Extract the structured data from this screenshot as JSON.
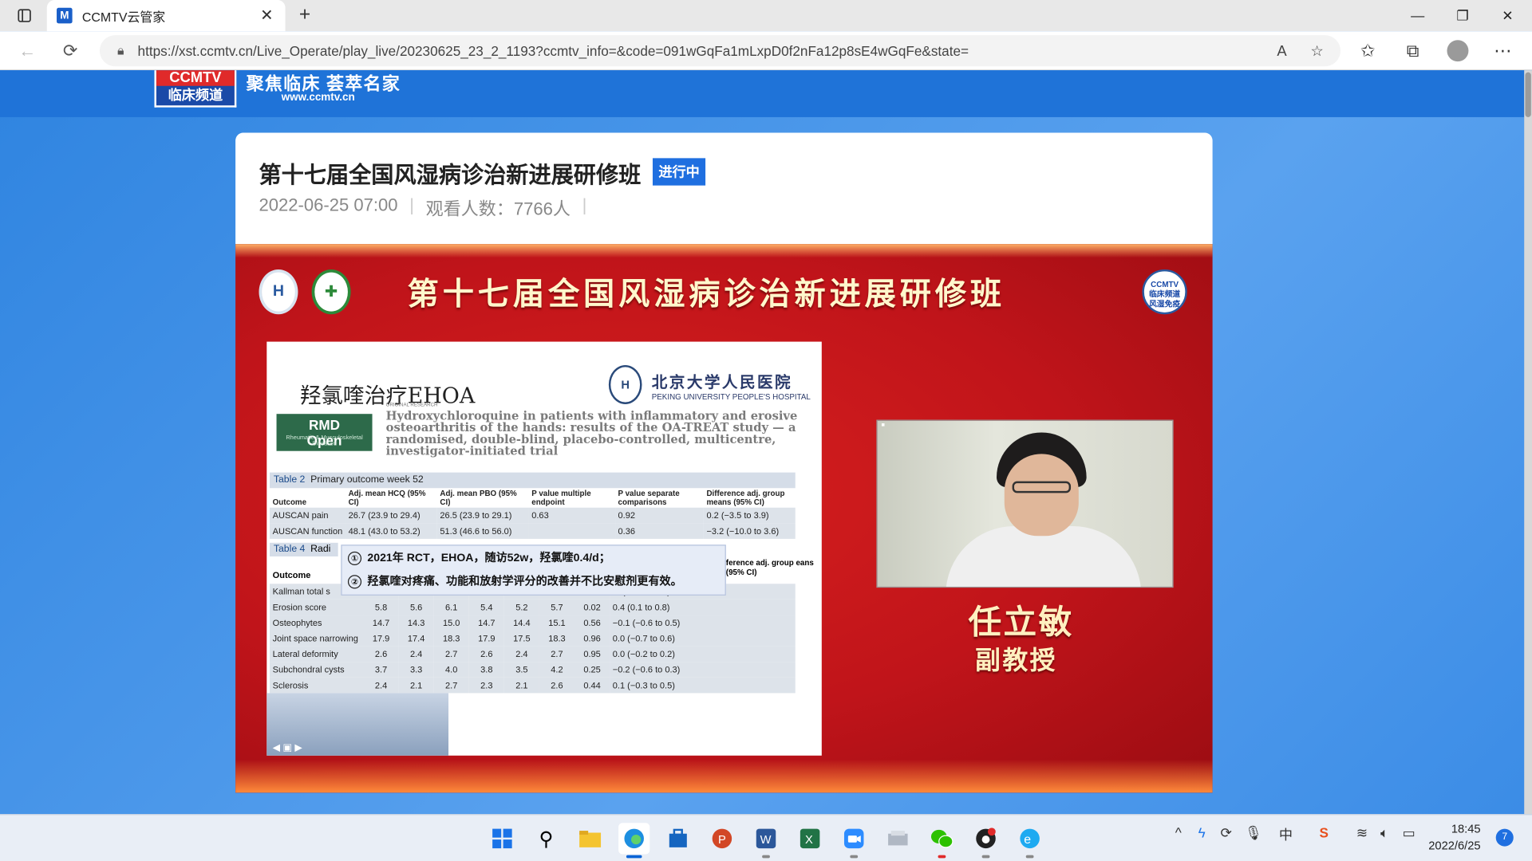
{
  "browser": {
    "tab_title": "CCMTV云管家",
    "tab_favicon": "M",
    "url": "https://xst.ccmtv.cn/Live_Operate/play_live/20230625_23_2_1193?ccmtv_info=&code=091wGqFa1mLxpD0f2nFa12p8sE4wGqFe&state="
  },
  "site": {
    "logo_top": "CCMTV",
    "logo_bottom": "临床频道",
    "slogan": "聚焦临床 荟萃名家",
    "site_url": "www.ccmtv.cn"
  },
  "live": {
    "title": "第十七届全国风湿病诊治新进展研修班",
    "status_badge": "进行中",
    "datetime": "2022-06-25 07:00",
    "viewers": "观看人数：7766人"
  },
  "video": {
    "banner_title": "第十七届全国风湿病诊治新进展研修班",
    "ccmtv_badge_top": "CCMTV",
    "ccmtv_badge_mid": "临床频道",
    "ccmtv_badge_bottom": "风湿免疫",
    "speaker_name": "任立敏",
    "speaker_title": "副教授"
  },
  "slide": {
    "title": "羟氯喹治疗EHOA",
    "hospital_cn": "北京大学人民医院",
    "hospital_en": "PEKING UNIVERSITY PEOPLE'S HOSPITAL",
    "journal_line1": "RMD",
    "journal_line2": "Open",
    "journal_sub": "Rheumatic & Musculoskeletal Diseases",
    "paper_kind": "ORIGINAL RESEARCH",
    "paper_title": "Hydroxychloroquine in patients with inflammatory and erosive osteoarthritis of the hands: results of the OA-TREAT study — a randomised, double-blind, placebo-controlled, multicentre, investigator-initiated trial",
    "table2_caption_label": "Table 2",
    "table2_caption": "Primary outcome week 52",
    "table2_headers": [
      "Outcome",
      "Adj. mean HCQ (95% CI)",
      "Adj. mean PBO (95% CI)",
      "P value multiple endpoint",
      "P value separate comparisons",
      "Difference adj. group means (95% CI)"
    ],
    "table2_rows": [
      [
        "AUSCAN pain",
        "26.7 (23.9 to 29.4)",
        "26.5 (23.9 to 29.1)",
        "0.63",
        "0.92",
        "0.2 (−3.5 to 3.9)"
      ],
      [
        "AUSCAN function",
        "48.1 (43.0 to 53.2)",
        "51.3 (46.6 to 56.0)",
        "",
        "0.36",
        "−3.2 (−10.0 to 3.6)"
      ]
    ],
    "table4_caption_label": "Table 4",
    "table4_caption": "Radi",
    "table4_header_outcome": "Outcome",
    "table4_header_diff": "ference adj. group eans (95% CI)",
    "table4_rows": [
      [
        "Kallman total s",
        "",
        "",
        "",
        "",
        "",
        "",
        "",
        ".3 (−1.2 to 1.9)"
      ],
      [
        "Erosion score",
        "5.8",
        "5.6",
        "6.1",
        "5.4",
        "5.2",
        "5.7",
        "0.02",
        "0.4 (0.1 to 0.8)"
      ],
      [
        "Osteophytes",
        "14.7",
        "14.3",
        "15.0",
        "14.7",
        "14.4",
        "15.1",
        "0.56",
        "−0.1 (−0.6 to 0.5)"
      ],
      [
        "Joint space narrowing",
        "17.9",
        "17.4",
        "18.3",
        "17.9",
        "17.5",
        "18.3",
        "0.96",
        "0.0 (−0.7 to 0.6)"
      ],
      [
        "Lateral deformity",
        "2.6",
        "2.4",
        "2.7",
        "2.6",
        "2.4",
        "2.7",
        "0.95",
        "0.0 (−0.2 to 0.2)"
      ],
      [
        "Subchondral cysts",
        "3.7",
        "3.3",
        "4.0",
        "3.8",
        "3.5",
        "4.2",
        "0.25",
        "−0.2 (−0.6 to 0.3)"
      ],
      [
        "Sclerosis",
        "2.4",
        "2.1",
        "2.7",
        "2.3",
        "2.1",
        "2.6",
        "0.44",
        "0.1 (−0.3 to 0.5)"
      ]
    ],
    "callout_1_num": "①",
    "callout_1": "2021年 RCT，EHOA，随访52w，羟氯喹0.4/d；",
    "callout_2_num": "②",
    "callout_2": "羟氯喹对疼痛、功能和放射学评分的改善并不比安慰剂更有效。"
  },
  "taskbar": {
    "time": "18:45",
    "date": "2022/6/25",
    "notification_count": "7"
  }
}
